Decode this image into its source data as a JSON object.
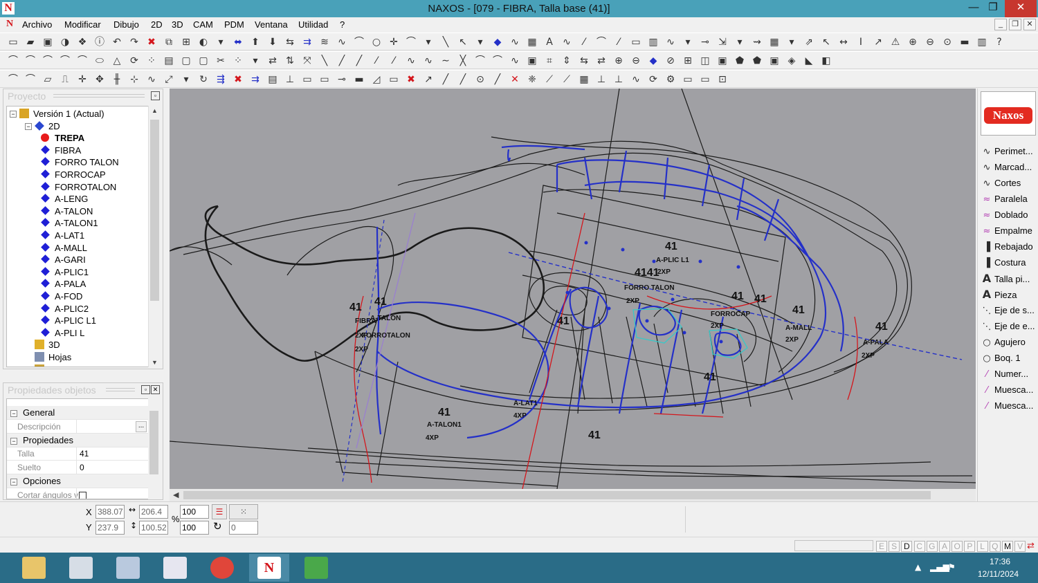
{
  "window": {
    "title": "NAXOS - [079 - FIBRA, Talla base (41)]",
    "minimize": "—",
    "restore": "❐",
    "close": "✕",
    "app_icon": "N"
  },
  "menu": {
    "logo": "N",
    "items": [
      "Archivo",
      "Modificar",
      "Dibujo",
      "2D",
      "3D",
      "CAM",
      "PDM",
      "Ventana",
      "Utilidad",
      "?"
    ],
    "mdi_controls": [
      "_",
      "❐",
      "✕"
    ]
  },
  "project_panel": {
    "title": "Proyecto",
    "tree": [
      {
        "label": "Versión 1 (Actual)",
        "icon": "version-icon",
        "expander": "−"
      },
      {
        "label": "2D",
        "icon": "2d-folder-icon",
        "expander": "−"
      },
      {
        "label": "TREPA",
        "icon": "red-dot-icon",
        "bold": true
      },
      {
        "label": "FIBRA",
        "icon": "diamond-icon"
      },
      {
        "label": "FORRO TALON",
        "icon": "diamond-icon"
      },
      {
        "label": "FORROCAP",
        "icon": "diamond-icon"
      },
      {
        "label": "FORROTALON",
        "icon": "diamond-icon"
      },
      {
        "label": "A-LENG",
        "icon": "diamond-icon"
      },
      {
        "label": "A-TALON",
        "icon": "diamond-icon"
      },
      {
        "label": "A-TALON1",
        "icon": "diamond-icon"
      },
      {
        "label": "A-LAT1",
        "icon": "diamond-icon"
      },
      {
        "label": "A-MALL",
        "icon": "diamond-icon"
      },
      {
        "label": "A-GARI",
        "icon": "diamond-icon"
      },
      {
        "label": "A-PLIC1",
        "icon": "diamond-icon"
      },
      {
        "label": "A-PALA",
        "icon": "diamond-icon"
      },
      {
        "label": "A-FOD",
        "icon": "diamond-icon"
      },
      {
        "label": "A-PLIC2",
        "icon": "diamond-icon"
      },
      {
        "label": "A-PLIC L1",
        "icon": "diamond-icon"
      },
      {
        "label": "A-PLI L",
        "icon": "diamond-icon"
      },
      {
        "label": "3D",
        "icon": "3d-icon"
      },
      {
        "label": "Hojas",
        "icon": "sheets-icon"
      },
      {
        "label": "PDM",
        "icon": "pdm-icon"
      }
    ]
  },
  "props_panel": {
    "title": "Propiedades objetos",
    "rows": [
      {
        "type": "cat",
        "label": "General"
      },
      {
        "type": "prop",
        "name": "Descripción",
        "value": "",
        "button": "..."
      },
      {
        "type": "cat",
        "label": "Propiedades"
      },
      {
        "type": "prop",
        "name": "Talla",
        "value": "41"
      },
      {
        "type": "prop",
        "name": "Suelto",
        "value": "0"
      },
      {
        "type": "cat",
        "label": "Opciones"
      },
      {
        "type": "prop",
        "name": "Cortar ángulos v",
        "value": ""
      }
    ]
  },
  "canvas": {
    "labels": [
      {
        "text": "41",
        "style": "big"
      },
      {
        "text": "41",
        "style": "big"
      },
      {
        "text": "FIBRA",
        "style": "small"
      },
      {
        "text": "A-TALON",
        "style": "small"
      },
      {
        "text": "2XP",
        "style": "small"
      },
      {
        "text": "FORROTALON",
        "style": "small"
      },
      {
        "text": "2XP",
        "style": "small"
      },
      {
        "text": "41",
        "style": "big"
      },
      {
        "text": "A-TALON1",
        "style": "small"
      },
      {
        "text": "4XP",
        "style": "small"
      },
      {
        "text": "A-LAT1",
        "style": "small"
      },
      {
        "text": "4XP",
        "style": "small"
      },
      {
        "text": "41",
        "style": "big"
      },
      {
        "text": "41",
        "style": "big"
      },
      {
        "text": "A-PLIC L1",
        "style": "small"
      },
      {
        "text": "4141",
        "style": "big"
      },
      {
        "text": "2XP",
        "style": "small"
      },
      {
        "text": "FORRO TALON",
        "style": "small"
      },
      {
        "text": "2XP",
        "style": "small"
      },
      {
        "text": "41",
        "style": "big"
      },
      {
        "text": "41",
        "style": "big"
      },
      {
        "text": "FORROCAP",
        "style": "small"
      },
      {
        "text": "2XP",
        "style": "small"
      },
      {
        "text": "41",
        "style": "big"
      },
      {
        "text": "A-MALL",
        "style": "small"
      },
      {
        "text": "2XP",
        "style": "small"
      },
      {
        "text": "41",
        "style": "big"
      },
      {
        "text": "A-PALA",
        "style": "small"
      },
      {
        "text": "2XP",
        "style": "small"
      },
      {
        "text": "41",
        "style": "big"
      },
      {
        "text": "41",
        "style": "big"
      }
    ]
  },
  "right_panel": {
    "logo": "Naxos",
    "items": [
      {
        "label": "Perimet...",
        "icon": "perimeter-icon"
      },
      {
        "label": "Marcad...",
        "icon": "marker-icon"
      },
      {
        "label": "Cortes",
        "icon": "cuts-icon"
      },
      {
        "label": "Paralela",
        "icon": "parallel-icon"
      },
      {
        "label": "Doblado",
        "icon": "fold-icon"
      },
      {
        "label": "Empalme",
        "icon": "join-icon"
      },
      {
        "label": "Rebajado",
        "icon": "skive-icon"
      },
      {
        "label": "Costura",
        "icon": "seam-icon"
      },
      {
        "label": "Talla pi...",
        "icon": "text-a-icon"
      },
      {
        "label": "Pieza",
        "icon": "text-a-icon"
      },
      {
        "label": "Eje de s...",
        "icon": "axis-icon"
      },
      {
        "label": "Eje de e...",
        "icon": "axis-icon"
      },
      {
        "label": "Agujero",
        "icon": "hole-icon"
      },
      {
        "label": "Boq. 1",
        "icon": "hole-icon"
      },
      {
        "label": "Numer...",
        "icon": "numbering-icon"
      },
      {
        "label": "Muesca...",
        "icon": "notch-icon"
      },
      {
        "label": "Muesca...",
        "icon": "notch-icon"
      }
    ]
  },
  "coords": {
    "x_label": "X",
    "y_label": "Y",
    "x_value": "388.07",
    "y_value": "237.9",
    "width_value": "206.4",
    "height_value": "100.52",
    "percent_label": "%",
    "scale_x": "100",
    "scale_y": "100",
    "rotation": "0"
  },
  "status_keys": [
    {
      "k": "E",
      "on": false
    },
    {
      "k": "S",
      "on": false
    },
    {
      "k": "D",
      "on": true
    },
    {
      "k": "C",
      "on": false
    },
    {
      "k": "G",
      "on": false
    },
    {
      "k": "A",
      "on": false
    },
    {
      "k": "O",
      "on": false
    },
    {
      "k": "P",
      "on": false
    },
    {
      "k": "L",
      "on": false
    },
    {
      "k": "Q",
      "on": false
    },
    {
      "k": "M",
      "on": true
    },
    {
      "k": "V",
      "on": false
    }
  ],
  "taskbar": {
    "time": "17:36",
    "date": "12/11/2024"
  },
  "colors": {
    "titlebar": "#49a1b9",
    "canvas": "#a0a0a4",
    "taskbar": "#2a6c87",
    "piece_blue": "#2430c8",
    "line_red": "#d4161c"
  }
}
